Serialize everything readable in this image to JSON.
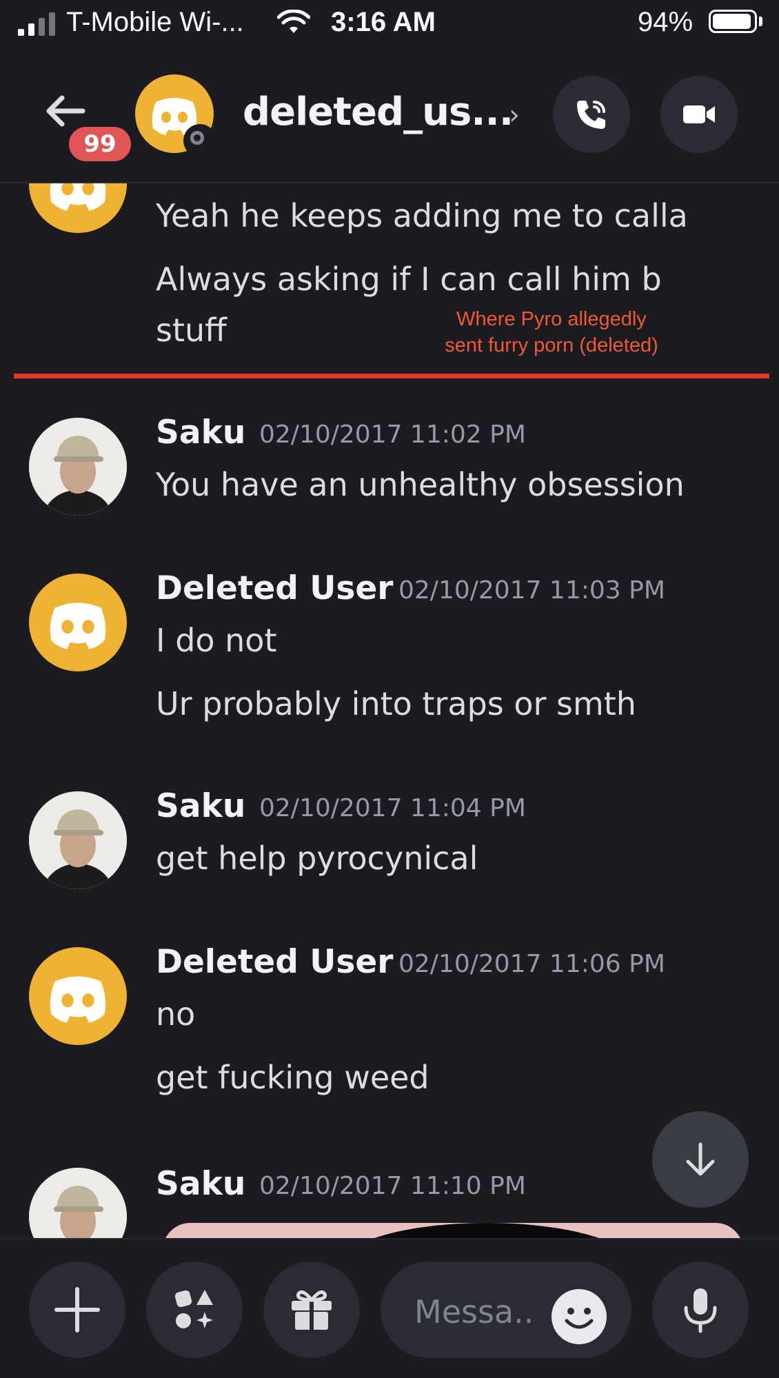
{
  "status_bar": {
    "carrier": "T-Mobile Wi-...",
    "time": "3:16 AM",
    "battery": "94%",
    "battery_level": 0.94
  },
  "header": {
    "unread_badge": "99",
    "channel_name": "deleted_us...",
    "chevron": "›"
  },
  "messages": {
    "top_group": {
      "lines": [
        "Yeah he keeps adding me to calla",
        "Always asking if I can call him b",
        "stuff"
      ]
    },
    "annotation": {
      "line1": "Where Pyro allegedly",
      "line2": "sent furry porn (deleted)",
      "color": "#e03a26"
    },
    "groups": [
      {
        "author": "Saku",
        "timestamp": "02/10/2017 11:02 PM",
        "lines": [
          "You have an unhealthy obsession"
        ]
      },
      {
        "author": "Deleted User",
        "timestamp": "02/10/2017 11:03 PM",
        "lines": [
          "I do not",
          "Ur probably into traps or smth"
        ]
      },
      {
        "author": "Saku",
        "timestamp": "02/10/2017 11:04 PM",
        "lines": [
          "get help pyrocynical"
        ]
      },
      {
        "author": "Deleted User",
        "timestamp": "02/10/2017 11:06 PM",
        "lines": [
          "no",
          "get fucking weed"
        ]
      },
      {
        "author": "Saku",
        "timestamp": "02/10/2017 11:10 PM",
        "lines": []
      }
    ]
  },
  "composer": {
    "placeholder": "Messa.."
  },
  "colors": {
    "background": "#1b1b21",
    "discord_avatar": "#f0b232",
    "badge": "#e05555"
  }
}
